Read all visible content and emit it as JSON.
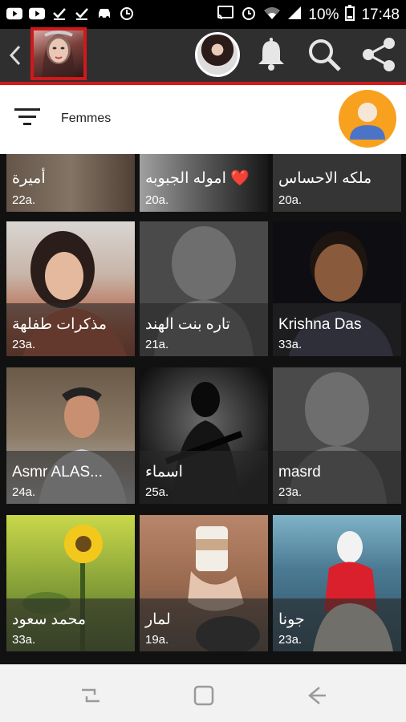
{
  "status_bar": {
    "left_icons": [
      "youtube-icon",
      "youtube-icon",
      "download-done-icon",
      "download-done-icon",
      "car-icon",
      "sync-icon"
    ],
    "battery": "10%",
    "time": "17:48"
  },
  "app_bar": {
    "icons": [
      "back-arrow-icon",
      "bell-icon",
      "search-icon",
      "share-icon"
    ],
    "accent_color": "#d0191b",
    "bar_color": "#2f2f2f"
  },
  "filter": {
    "label": "Femmes",
    "avatar_color": "#f7a11f"
  },
  "profiles": [
    {
      "name": "أميرة",
      "age": "22a."
    },
    {
      "name": "اموله الجبوبه ❤️",
      "age": "20a."
    },
    {
      "name": "ملكه الاحساس",
      "age": "20a."
    },
    {
      "name": "مذكرات طفلهة",
      "age": "23a."
    },
    {
      "name": "تاره بنت الهند",
      "age": "21a."
    },
    {
      "name": "Krishna Das",
      "age": "33a."
    },
    {
      "name": "Asmr ALAS...",
      "age": "24a."
    },
    {
      "name": "اسماء",
      "age": "25a."
    },
    {
      "name": "masrd",
      "age": "23a."
    },
    {
      "name": "محمد سعود",
      "age": "33a."
    },
    {
      "name": "لمار",
      "age": "19a."
    },
    {
      "name": "جونا",
      "age": "23a."
    }
  ],
  "nav_bar": {
    "icons": [
      "recents-icon",
      "home-icon",
      "back-icon"
    ]
  }
}
